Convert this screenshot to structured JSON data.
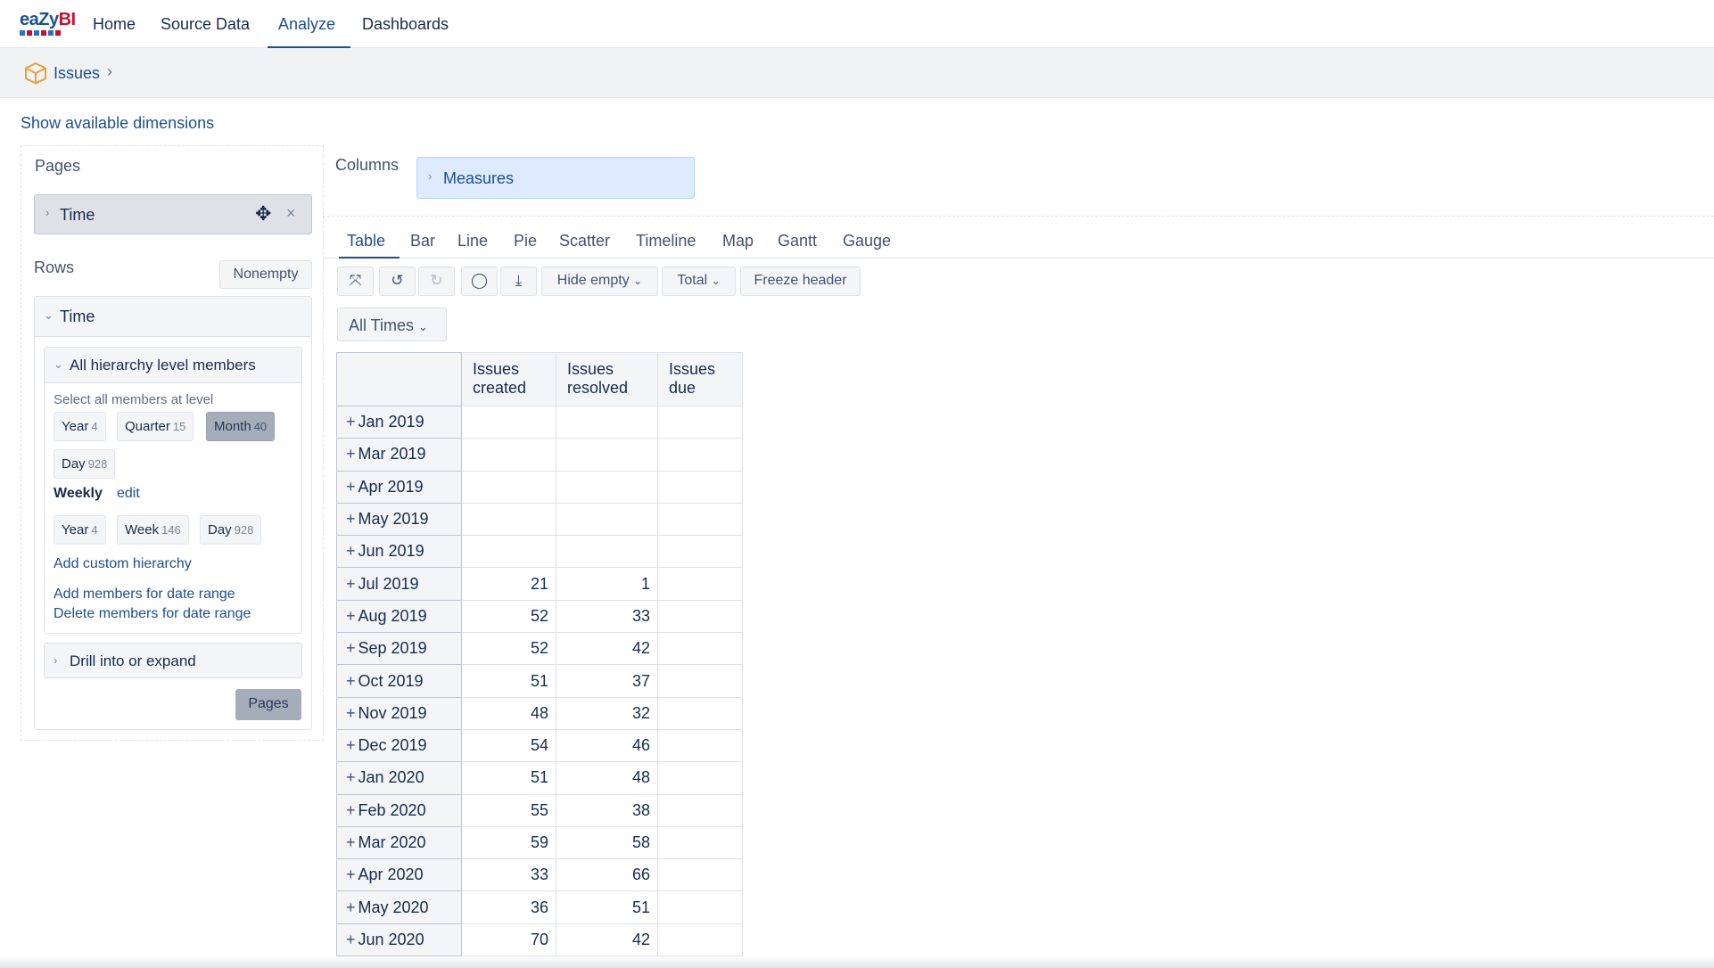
{
  "app": {
    "logo_text_a": "eaZy",
    "logo_text_b": "BI"
  },
  "nav": {
    "items": [
      {
        "label": "Home"
      },
      {
        "label": "Source Data"
      },
      {
        "label": "Analyze"
      },
      {
        "label": "Dashboards"
      }
    ],
    "active": "Analyze"
  },
  "breadcrumb": {
    "cube": "Issues",
    "separator": "›"
  },
  "show_dimensions": "Show available dimensions",
  "pages": {
    "title": "Pages",
    "dimension": "Time",
    "close": "×"
  },
  "rows": {
    "title": "Rows",
    "nonempty_label": "Nonempty",
    "dimension": "Time",
    "hierarchy_section": "All hierarchy level members",
    "select_all_label": "Select all members at level",
    "levels": [
      {
        "name": "Year",
        "count": "4",
        "selected": false
      },
      {
        "name": "Quarter",
        "count": "15",
        "selected": false
      },
      {
        "name": "Month",
        "count": "40",
        "selected": true
      },
      {
        "name": "Day",
        "count": "928",
        "selected": false
      }
    ],
    "weekly_label": "Weekly",
    "weekly_edit": "edit",
    "weekly_levels": [
      {
        "name": "Year",
        "count": "4"
      },
      {
        "name": "Week",
        "count": "146"
      },
      {
        "name": "Day",
        "count": "928"
      }
    ],
    "add_custom_hierarchy": "Add custom hierarchy",
    "add_members_range": "Add members for date range",
    "delete_members_range": "Delete members for date range",
    "drill_section": "Drill into or expand",
    "pages_button": "Pages"
  },
  "columns": {
    "title": "Columns",
    "dimension": "Measures"
  },
  "view_tabs": [
    "Table",
    "Bar",
    "Line",
    "Pie",
    "Scatter",
    "Timeline",
    "Map",
    "Gantt",
    "Gauge"
  ],
  "active_tab": "Table",
  "toolbar": {
    "hide_empty": "Hide empty",
    "total": "Total",
    "freeze_header": "Freeze header"
  },
  "page_selector": "All Times",
  "table": {
    "headers": [
      [
        "Issues",
        "created"
      ],
      [
        "Issues",
        "resolved"
      ],
      [
        "Issues",
        "due"
      ]
    ],
    "rows": [
      {
        "label": "Jan 2019",
        "created": "",
        "resolved": "",
        "due": ""
      },
      {
        "label": "Mar 2019",
        "created": "",
        "resolved": "",
        "due": ""
      },
      {
        "label": "Apr 2019",
        "created": "",
        "resolved": "",
        "due": ""
      },
      {
        "label": "May 2019",
        "created": "",
        "resolved": "",
        "due": ""
      },
      {
        "label": "Jun 2019",
        "created": "",
        "resolved": "",
        "due": ""
      },
      {
        "label": "Jul 2019",
        "created": "21",
        "resolved": "1",
        "due": ""
      },
      {
        "label": "Aug 2019",
        "created": "52",
        "resolved": "33",
        "due": ""
      },
      {
        "label": "Sep 2019",
        "created": "52",
        "resolved": "42",
        "due": ""
      },
      {
        "label": "Oct 2019",
        "created": "51",
        "resolved": "37",
        "due": ""
      },
      {
        "label": "Nov 2019",
        "created": "48",
        "resolved": "32",
        "due": ""
      },
      {
        "label": "Dec 2019",
        "created": "54",
        "resolved": "46",
        "due": ""
      },
      {
        "label": "Jan 2020",
        "created": "51",
        "resolved": "48",
        "due": ""
      },
      {
        "label": "Feb 2020",
        "created": "55",
        "resolved": "38",
        "due": ""
      },
      {
        "label": "Mar 2020",
        "created": "59",
        "resolved": "58",
        "due": ""
      },
      {
        "label": "Apr 2020",
        "created": "33",
        "resolved": "66",
        "due": ""
      },
      {
        "label": "May 2020",
        "created": "36",
        "resolved": "51",
        "due": ""
      },
      {
        "label": "Jun 2020",
        "created": "70",
        "resolved": "42",
        "due": ""
      }
    ]
  }
}
